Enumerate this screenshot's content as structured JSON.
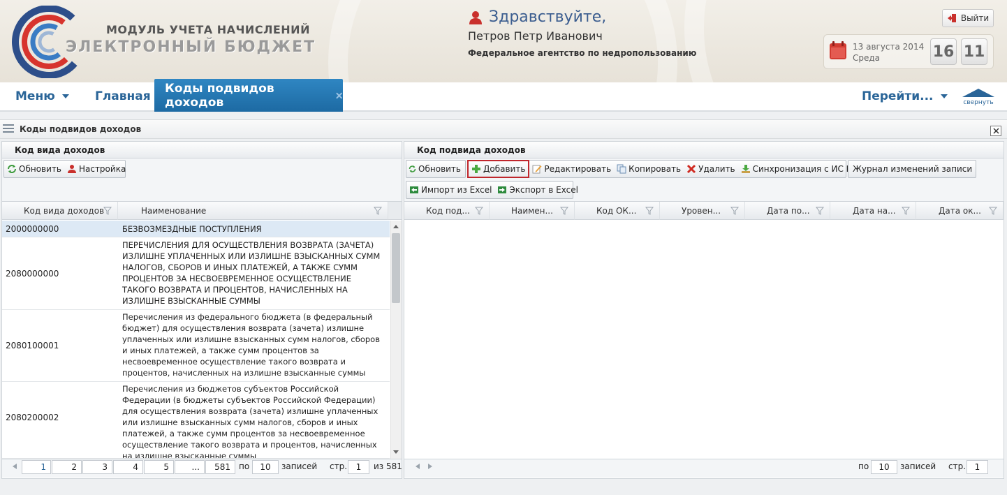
{
  "header": {
    "logo_line1": "МОДУЛЬ УЧЕТА НАЧИСЛЕНИЙ",
    "logo_line2": "ЭЛЕКТРОННЫЙ БЮДЖЕТ",
    "greeting": "Здравствуйте,",
    "user_name": "Петров Петр Иванович",
    "agency": "Федеральное агентство по недропользованию",
    "logout_label": "Выйти",
    "date": "13 августа 2014",
    "weekday": "Среда",
    "clock_hours": "16",
    "clock_minutes": "11"
  },
  "nav": {
    "menu": "Меню",
    "home": "Главная",
    "active_tab": "Коды подвидов доходов",
    "goto": "Перейти...",
    "collapse": "свернуть"
  },
  "panel_title": "Коды подвидов доходов",
  "left": {
    "title": "Код вида доходов",
    "buttons": {
      "refresh": "Обновить",
      "settings": "Настройка"
    },
    "columns": [
      "Код вида доходов",
      "Наименование"
    ],
    "rows": [
      {
        "code": "2000000000",
        "name": "БЕЗВОЗМЕЗДНЫЕ ПОСТУПЛЕНИЯ"
      },
      {
        "code": "2080000000",
        "name": "ПЕРЕЧИСЛЕНИЯ ДЛЯ ОСУЩЕСТВЛЕНИЯ ВОЗВРАТА (ЗАЧЕТА) ИЗЛИШНЕ УПЛАЧЕННЫХ ИЛИ ИЗЛИШНЕ ВЗЫСКАННЫХ СУММ НАЛОГОВ, СБОРОВ И ИНЫХ ПЛАТЕЖЕЙ, А ТАКЖЕ СУММ ПРОЦЕНТОВ ЗА НЕСВОЕВРЕМЕННОЕ ОСУЩЕСТВЛЕНИЕ ТАКОГО ВОЗВРАТА И ПРОЦЕНТОВ, НАЧИСЛЕННЫХ НА ИЗЛИШНЕ ВЗЫСКАННЫЕ СУММЫ"
      },
      {
        "code": "2080100001",
        "name": "Перечисления из федерального бюджета (в федеральный бюджет) для осуществления возврата (зачета) излишне уплаченных или излишне взысканных сумм налогов, сборов и иных платежей, а также сумм процентов за несвоевременное осуществление такого возврата и процентов, начисленных на излишне взысканные суммы"
      },
      {
        "code": "2080200002",
        "name": "Перечисления из бюджетов субъектов Российской Федерации (в бюджеты субъектов Российской Федерации) для осуществления возврата (зачета) излишне уплаченных или излишне взысканных сумм налогов, сборов и иных платежей, а также сумм процентов за несвоевременное осуществление такого возврата и процентов, начисленных на излишне взысканные суммы"
      }
    ],
    "pager": {
      "pages": [
        "1",
        "2",
        "3",
        "4",
        "5",
        "...",
        "581"
      ],
      "per_label": "по",
      "per_value": "10",
      "records_label": "записей",
      "page_label": "стр.",
      "page_value": "1",
      "of_label": "из 581"
    }
  },
  "right": {
    "title": "Код подвида доходов",
    "buttons": {
      "refresh": "Обновить",
      "add": "Добавить",
      "edit": "Редактировать",
      "copy": "Копировать",
      "delete": "Удалить",
      "sync": "Синхронизация с ИС НСИ",
      "journal": "Журнал изменений записи",
      "import": "Импорт из Excel",
      "export": "Экспорт в Excel"
    },
    "columns": [
      "Код под...",
      "Наимен...",
      "Код ОК...",
      "Уровен...",
      "Дата по...",
      "Дата на...",
      "Дата ок..."
    ],
    "pager": {
      "per_label": "по",
      "per_value": "10",
      "records_label": "записей",
      "page_label": "стр.",
      "page_value": "1"
    }
  },
  "colors": {
    "brand_blue": "#2a6598",
    "tab_blue": "#1d6aa3",
    "selected_row": "#dde9f5",
    "add_highlight": "#c0262c"
  }
}
